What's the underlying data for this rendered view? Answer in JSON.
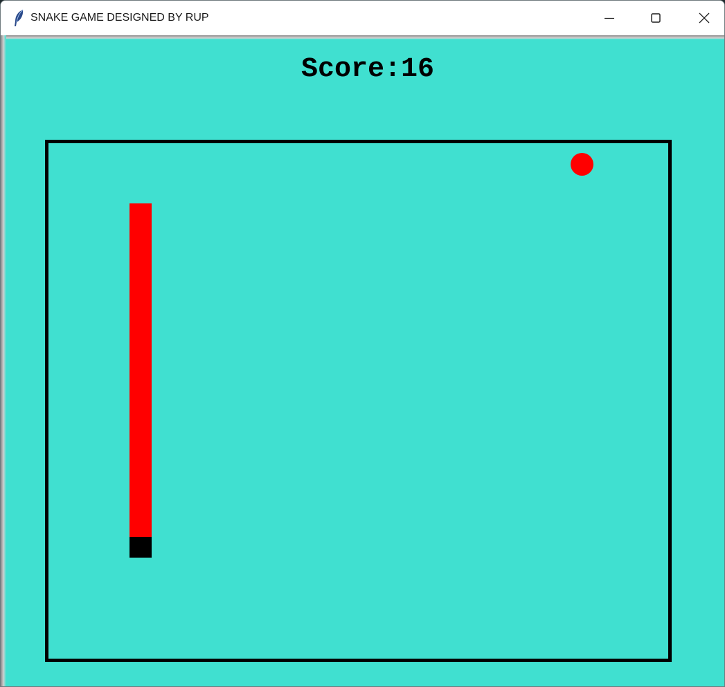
{
  "window": {
    "title": "SNAKE GAME DESIGNED BY RUP",
    "icon": "feather-icon",
    "controls": {
      "minimize_icon": "minimize-icon",
      "maximize_icon": "maximize-icon",
      "close_icon": "close-icon"
    }
  },
  "game": {
    "score_text": "Score:16",
    "colors": {
      "background": "#40e0d0",
      "border": "#000000",
      "snake_body": "#ff0000",
      "snake_head": "#000000",
      "food": "#ff0000"
    }
  }
}
